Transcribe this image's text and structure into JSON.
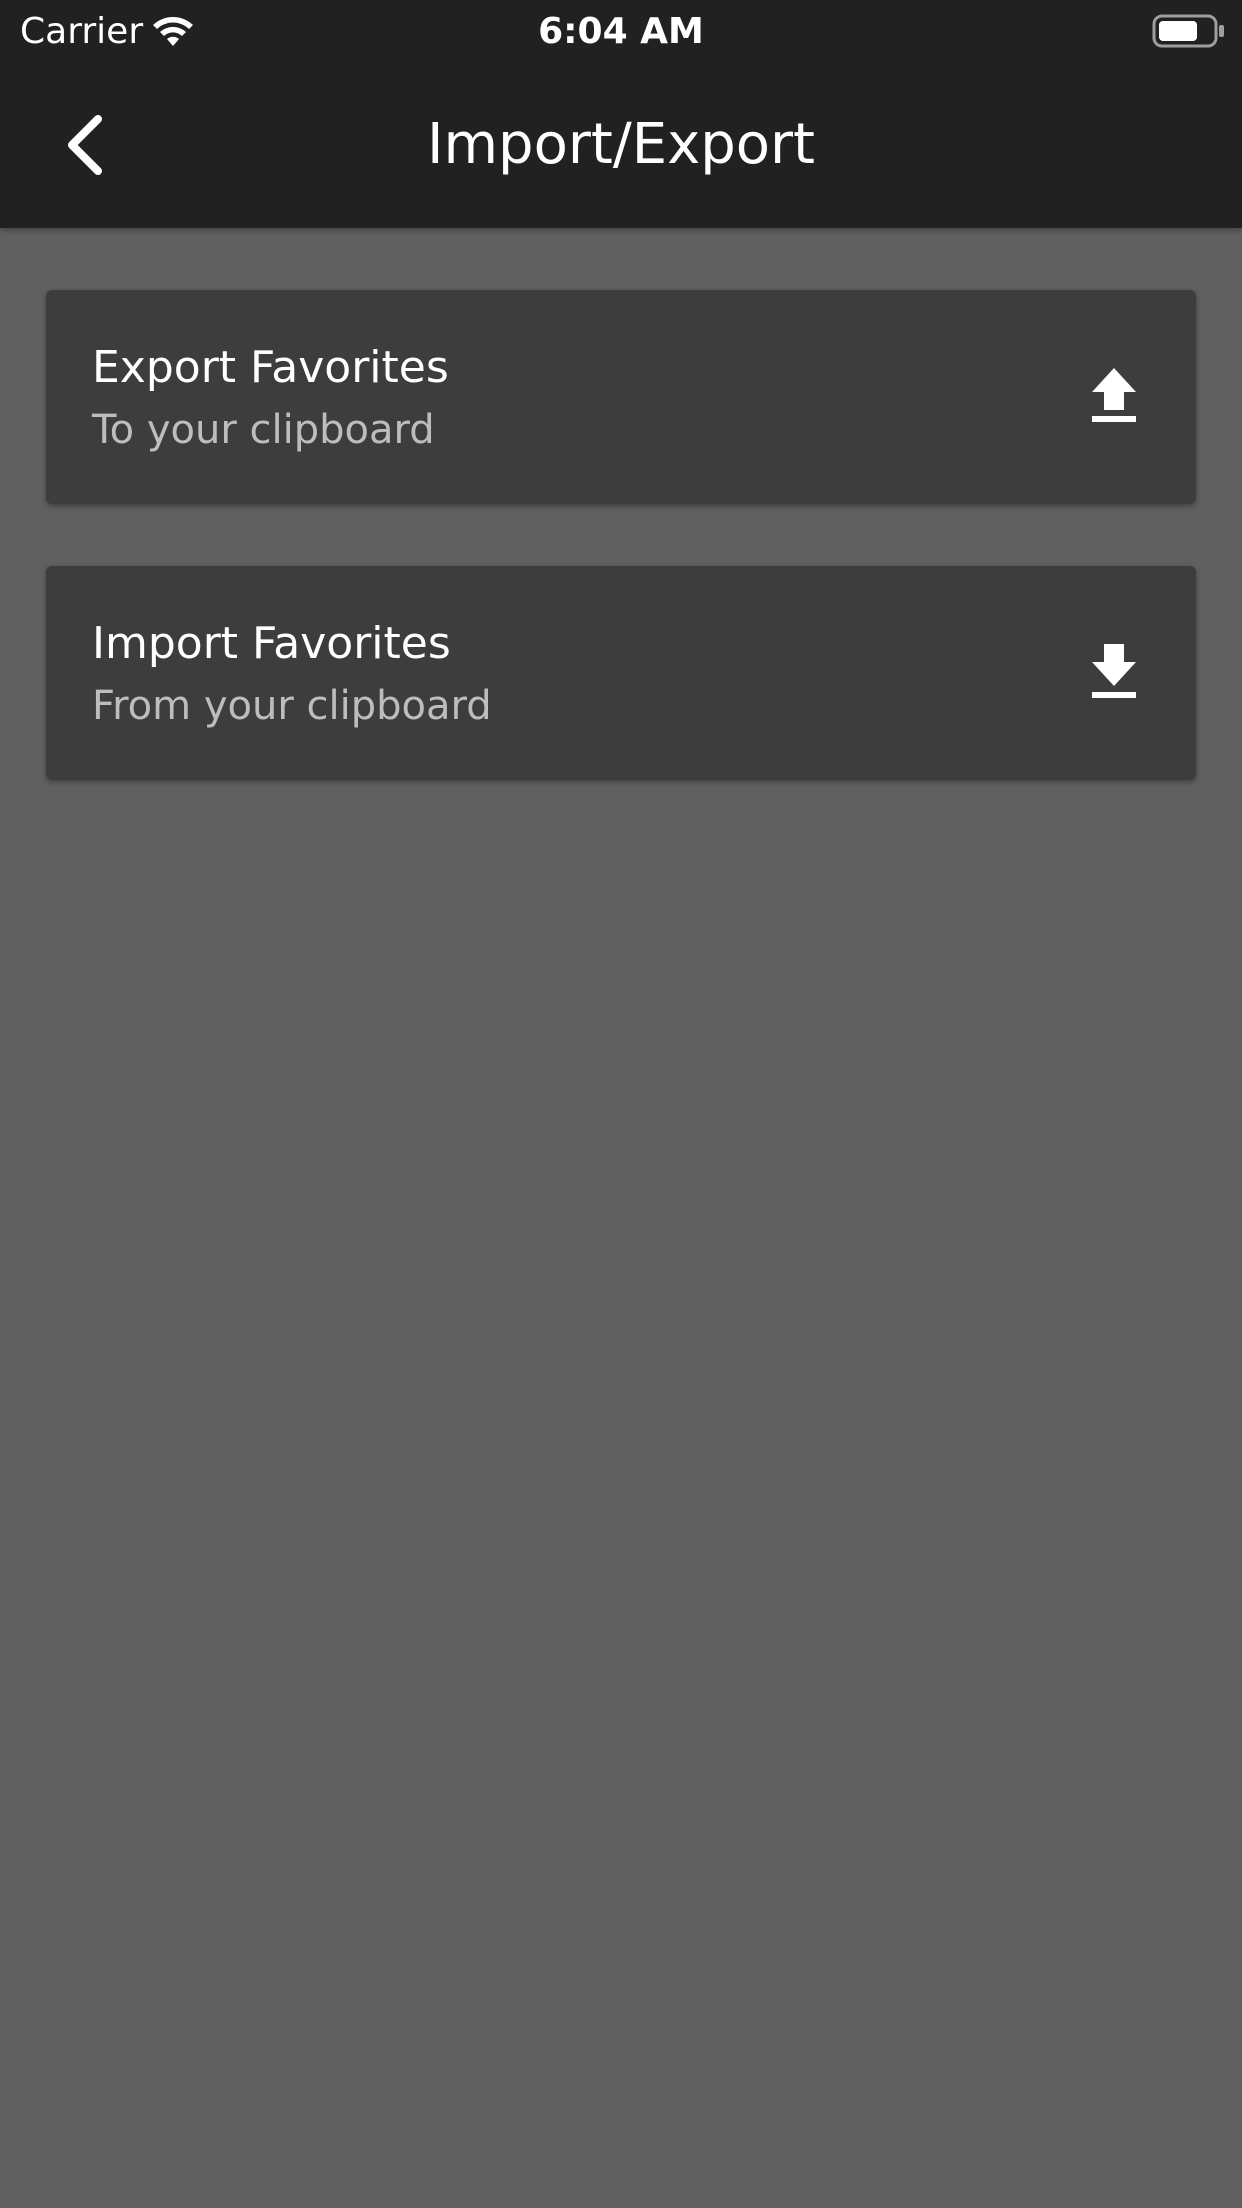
{
  "status_bar": {
    "carrier": "Carrier",
    "time": "6:04 AM",
    "icons": [
      "wifi-icon",
      "battery-icon"
    ]
  },
  "header": {
    "title": "Import/Export",
    "back_icon": "back-chevron-icon"
  },
  "cards": [
    {
      "title": "Export Favorites",
      "subtitle": "To your clipboard",
      "icon": "upload-icon"
    },
    {
      "title": "Import Favorites",
      "subtitle": "From your clipboard",
      "icon": "download-icon"
    }
  ],
  "colors": {
    "appbar": "#212121",
    "background": "#606060",
    "card": "#3d3d3d",
    "text_primary": "#ffffff",
    "text_secondary": "#bdbdbd"
  }
}
